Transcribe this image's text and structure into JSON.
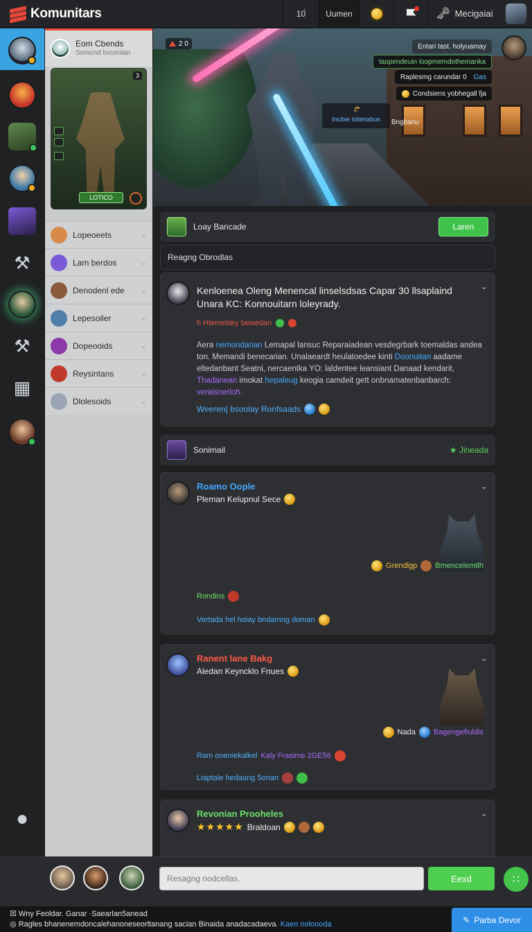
{
  "app": {
    "title": "Komunitars",
    "brand_color": "#e4473b",
    "accent": "#3ec24a"
  },
  "topbar": {
    "count": "10́",
    "menu_label": "Uumen",
    "coin_icon": "coin-icon",
    "flag_icon": "flag-icon",
    "user_name": "Mecigaiai"
  },
  "rail": {
    "items": [
      {
        "name": "rail-avatar-active"
      },
      {
        "name": "rail-avatar-red"
      },
      {
        "name": "rail-avatar-forest"
      },
      {
        "name": "rail-avatar-blue"
      },
      {
        "name": "rail-avatar-purple"
      },
      {
        "name": "rail-wrench-icon"
      },
      {
        "name": "rail-avatar-glow"
      },
      {
        "name": "rail-tool-icon"
      },
      {
        "name": "rail-building-icon"
      },
      {
        "name": "rail-avatar-bottom"
      },
      {
        "name": "rail-chat-icon"
      }
    ]
  },
  "sidebar": {
    "profile_name": "Eom Cbends",
    "profile_sub": "Somcnd bvcenlan",
    "card_tag": "3",
    "card_button": "LOTICO",
    "categories": [
      {
        "label": "Lopeoeets",
        "color": "#d88a4a"
      },
      {
        "label": "Lam berdos",
        "color": "#7b5ad8"
      },
      {
        "label": "Denodenl ede",
        "color": "#8a5a3a"
      },
      {
        "label": "Lepesoiler",
        "color": "#4f7fa8"
      },
      {
        "label": "Dopeooids",
        "color": "#8b3aa8"
      },
      {
        "label": "Reysintans",
        "color": "#c0392b"
      },
      {
        "label": "Dlolesoids",
        "color": "#9aa4b4"
      }
    ]
  },
  "banner": {
    "chip": "2 0",
    "pill1": "Entari tast. holyuamay",
    "pill2": "taopendeuin loopmemdothemanka",
    "pill3": "Raplesmg carundar 0",
    "pill3_extra": "Gas",
    "pill4": "Condsiens yobhegall fja",
    "overlay_top": "F́̂̃̄̅̆",
    "overlay_bottom": "Incibie lobietabus",
    "side_text": "Bngbanu"
  },
  "section1": {
    "title": "Loay Bancade",
    "button": "Laren"
  },
  "search": {
    "placeholder": "Reagng Obrodlas"
  },
  "post1": {
    "title": "Kenloenea Oleng Menencal linselsdsas Capar 30 llsaplaind Unara KC: Konnouitarn loleyrady.",
    "tag": "h Hlemelaky beisedan",
    "body_a": "Aera ",
    "body_hl1": "nemondarian",
    "body_b": " Lemapal lansuc Reparaiadean vesdegrbark toemaldas andea ton. Memandi benecarian. Unalaeardt heulatoedee kinti ",
    "body_hl2": "Doonuitan",
    "body_c": " aadame eltedanbant Seatni, nercaentka YO: laldentee leansiant Danaad kendarit, ",
    "body_vio": "Thadanean",
    "body_d": " imokat ",
    "body_hl3": "hepaleug",
    "body_e": " keogia camdeit gett onbnamatenbanbarch: ",
    "body_vio2": "veraisnerloh.",
    "link": "Weeren| bsoolay Ronfsaads"
  },
  "section2": {
    "title": "Sonimail",
    "right_label": "Jineada"
  },
  "post2": {
    "name": "Roamo Oople",
    "sub": "Pleman Kelupnul Sece",
    "badge": "Grendlgp",
    "badge2": "Bmencelemtlh",
    "line1": "Rondins",
    "line2": "Vertada hel hoiay bndamng doman"
  },
  "post3": {
    "name": "Ranent lane Bakg",
    "sub": "Aledan Keyncklo Fnues",
    "badge": "Nada",
    "badge2": "Bagengefiuldis",
    "line1": "Ram oneniekalkel",
    "line1b": "Kaly Frasime 2GE56",
    "line2": "Liaptale hedaang 5onan"
  },
  "post4": {
    "name": "Revonian Prooheles",
    "stars": "★★★★★",
    "sub": "Braldoan"
  },
  "composer": {
    "placeholder": "Resagng nodcellas.",
    "send": "Eexd"
  },
  "footer": {
    "line1": "Wny Feoldar. Ganar  ·Saearlan5anead",
    "line2": "Ragles bhanenemdoncalehanoneseorltanang sacian Binaida anadacadaeva.",
    "link": "Kaeo noloooda",
    "button": "Parba Devor"
  }
}
